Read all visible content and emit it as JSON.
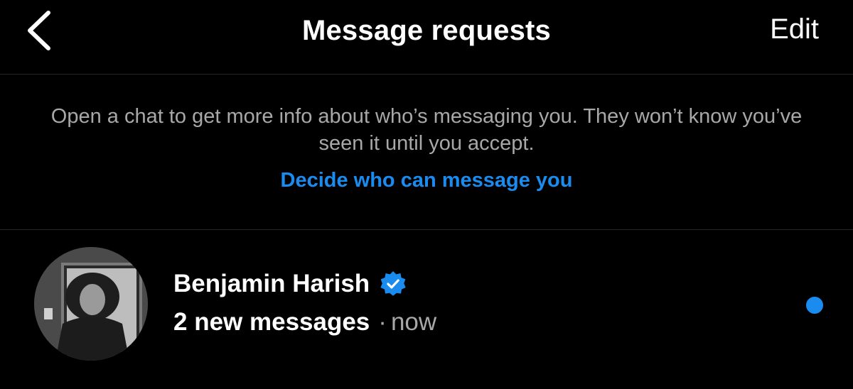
{
  "header": {
    "title": "Message requests",
    "edit_label": "Edit",
    "back_icon": "chevron-left-icon"
  },
  "info": {
    "description": "Open a chat to get more info about who’s messaging you. They won’t know you’ve seen it until you accept.",
    "link_label": "Decide who can message you"
  },
  "requests": [
    {
      "name": "Benjamin Harish",
      "verified": true,
      "message_count": "2 new messages",
      "separator": "·",
      "time": "now",
      "unread": true
    }
  ],
  "colors": {
    "background": "#000000",
    "accent": "#1a8cf0",
    "secondary_text": "#a8a8a8",
    "divider": "#262626"
  }
}
